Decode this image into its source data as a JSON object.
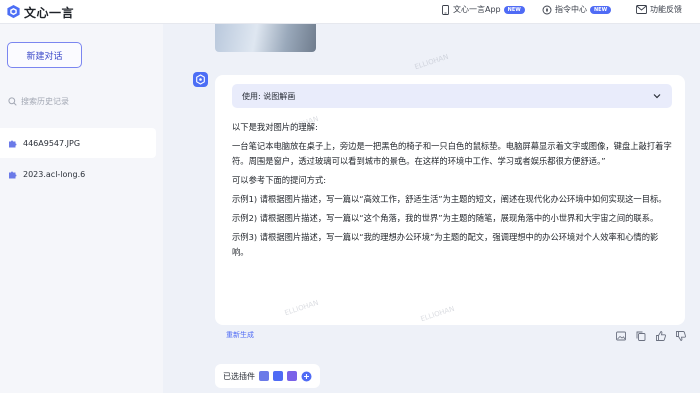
{
  "app": {
    "title": "文心一言",
    "brand_color": "#4c6ef5"
  },
  "topbar": {
    "links": [
      {
        "label": "文心一言App",
        "badge": "NEW",
        "icon": "phone-icon"
      },
      {
        "label": "指令中心",
        "badge": "NEW",
        "icon": "compass-icon"
      },
      {
        "label": "功能反馈",
        "badge": "",
        "icon": "mail-icon"
      }
    ]
  },
  "sidebar": {
    "new_chat_label": "新建对话",
    "search_placeholder": "搜索历史记录",
    "history": [
      {
        "label": "446A9547.JPG",
        "active": true
      },
      {
        "label": "2023.acl-long.6",
        "active": false
      }
    ]
  },
  "chat": {
    "usage_label": "使用: 说图解画",
    "paragraphs": [
      "以下是我对图片的理解:",
      "一台笔记本电脑放在桌子上，旁边是一把黑色的椅子和一只白色的鼠标垫。电脑屏幕显示着文字或图像，键盘上敲打着字符。周围是窗户，透过玻璃可以看到城市的景色。在这样的环境中工作、学习或者娱乐都很方便舒适。”",
      "可以参考下面的提问方式:",
      "示例1) 请根据图片描述，写一篇以“高效工作，舒适生活”为主题的短文，阐述在现代化办公环境中如何实现这一目标。",
      "示例2) 请根据图片描述，写一篇以“这个角落，我的世界”为主题的随笔，展现角落中的小世界和大宇宙之间的联系。",
      "示例3) 请根据图片描述，写一篇以“我的理想办公环境”为主题的配文，强调理想中的办公环境对个人效率和心情的影响。"
    ],
    "regenerate_label": "重新生成",
    "plugins_label": "已选插件"
  },
  "watermark_text": "ELLIOHAN"
}
